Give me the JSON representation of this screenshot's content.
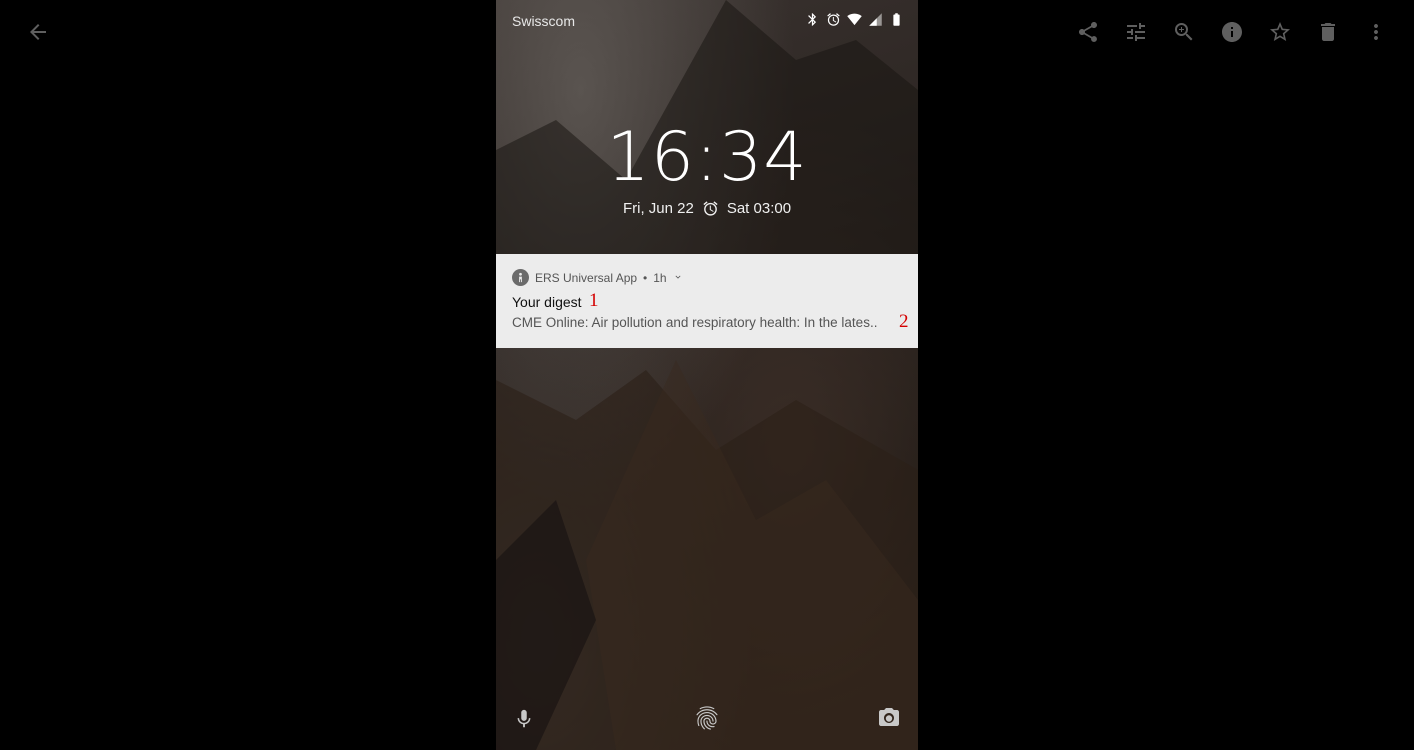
{
  "viewer": {
    "toolbar_icons": [
      "back-arrow-icon",
      "share-icon",
      "tune-icon",
      "zoom-icon",
      "info-icon",
      "star-icon",
      "delete-icon",
      "more-vert-icon"
    ]
  },
  "lockscreen": {
    "carrier": "Swisscom",
    "status_icons": [
      "bluetooth-icon",
      "alarm-icon",
      "wifi-icon",
      "signal-icon",
      "battery-icon"
    ],
    "time": "16:34",
    "date": "Fri, Jun 22",
    "next_alarm": "Sat 03:00",
    "bottom_icons": [
      "microphone-icon",
      "fingerprint-icon",
      "camera-icon"
    ]
  },
  "notification": {
    "app_name": "ERS Universal App",
    "separator": "•",
    "age": "1h",
    "title": "Your digest",
    "body": "CME Online: Air pollution and respiratory health: In the lates..",
    "marker_1": "1",
    "marker_2": "2"
  },
  "colors": {
    "viewer_bg": "#000000",
    "viewer_icon": "#5f5f5f",
    "notification_bg": "#ececec",
    "annotation_red": "#d40000"
  }
}
